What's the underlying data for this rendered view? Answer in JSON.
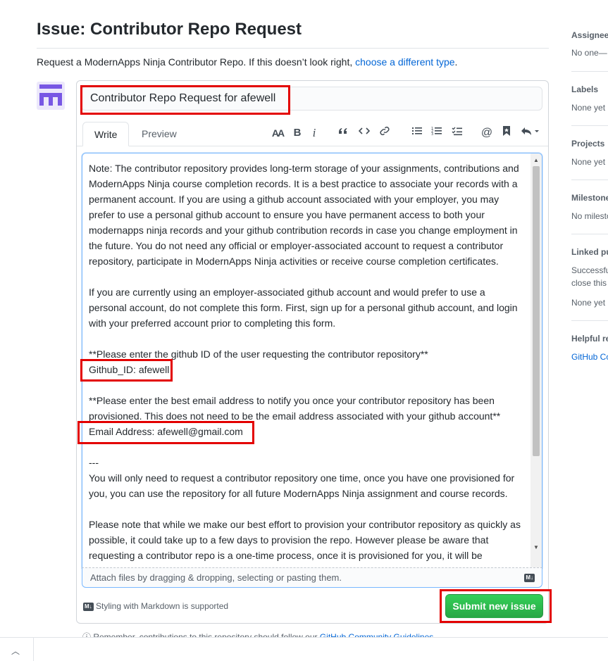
{
  "page": {
    "title": "Issue: Contributor Repo Request",
    "subtitle_text": "Request a ModernApps Ninja Contributor Repo. If this doesn’t look right, ",
    "subtitle_link": "choose a different type",
    "subtitle_end": "."
  },
  "form": {
    "title_value": "Contributor Repo Request for afewell",
    "tabs": [
      {
        "label": "Write",
        "active": true
      },
      {
        "label": "Preview",
        "active": false
      }
    ],
    "toolbar_icons": [
      "text-size-icon",
      "bold-icon",
      "italic-icon",
      "quote-icon",
      "code-icon",
      "link-icon",
      "unordered-list-icon",
      "ordered-list-icon",
      "task-list-icon",
      "mention-icon",
      "reference-icon",
      "reply-icon"
    ],
    "toolbar_labels": {
      "text_size": "AA",
      "bold": "B",
      "italic": "i"
    },
    "body_lines": [
      [
        "Note: The contributor repository provides long-term storage of your assignments, contributions and",
        "ModernApps Ninja course completion records. It is a best practice to associate your records with a",
        "permanent account. If you are using a github account associated with your employer, you may",
        "prefer to use a personal github account to ensure you have permanent access to both your",
        "modernapps ninja records and your github contribution records in case you change employment in",
        "the future. You do not need any official or employer-associated account to request a contributor",
        "repository, participate in ModernApps Ninja activities or receive course completion certificates."
      ],
      [
        "If you are currently using an employer-associated github account and would prefer to use a",
        "personal account, do not complete this form. First, sign up for a personal github account, and login",
        "with your preferred account prior to completing this form."
      ],
      [
        "**Please enter the github ID of the user requesting the contributor repository**",
        "Github_ID: afewell"
      ],
      [
        "**Please enter the best email address to notify you once your contributor repository has been",
        "provisioned. This does not need to be the email address associated with your github account**",
        "Email Address: afewell@gmail.com"
      ],
      [
        "---",
        "You will only need to request a contributor repository one time, once you have one provisioned for",
        "you, you can use the repository for all future ModernApps Ninja assignment and course records."
      ],
      [
        "Please note that while we make our best effort to provision your contributor repository as quickly as",
        "possible, it could take up to a few days to provision the repo. However please be aware that",
        "requesting a contributor repo is a one-time process, once it is provisioned for you, it will be"
      ]
    ],
    "attach_text": "Attach files by dragging & dropping, selecting or pasting them.",
    "markdown_badge": "M↓",
    "markdown_note": "Styling with Markdown is supported",
    "submit_label": "Submit new issue",
    "guidelines_text": "Remember, contributions to this repository should follow our ",
    "guidelines_link": "GitHub Community Guidelines"
  },
  "sidebar": {
    "assignees": {
      "heading": "Assignees",
      "value": "No one—"
    },
    "labels": {
      "heading": "Labels",
      "value": "None yet"
    },
    "projects": {
      "heading": "Projects",
      "value": "None yet"
    },
    "milestone": {
      "heading": "Milestone",
      "value": "No milesto"
    },
    "linked": {
      "heading": "Linked pu",
      "line1": "Successful",
      "line2": "close this",
      "value": "None yet"
    },
    "helpful": {
      "heading": "Helpful re",
      "link": "GitHub Co"
    }
  },
  "colors": {
    "accent": "#0366d6",
    "submit": "#2ea44f",
    "highlight": "#e30000",
    "avatar": "#7857e4"
  }
}
